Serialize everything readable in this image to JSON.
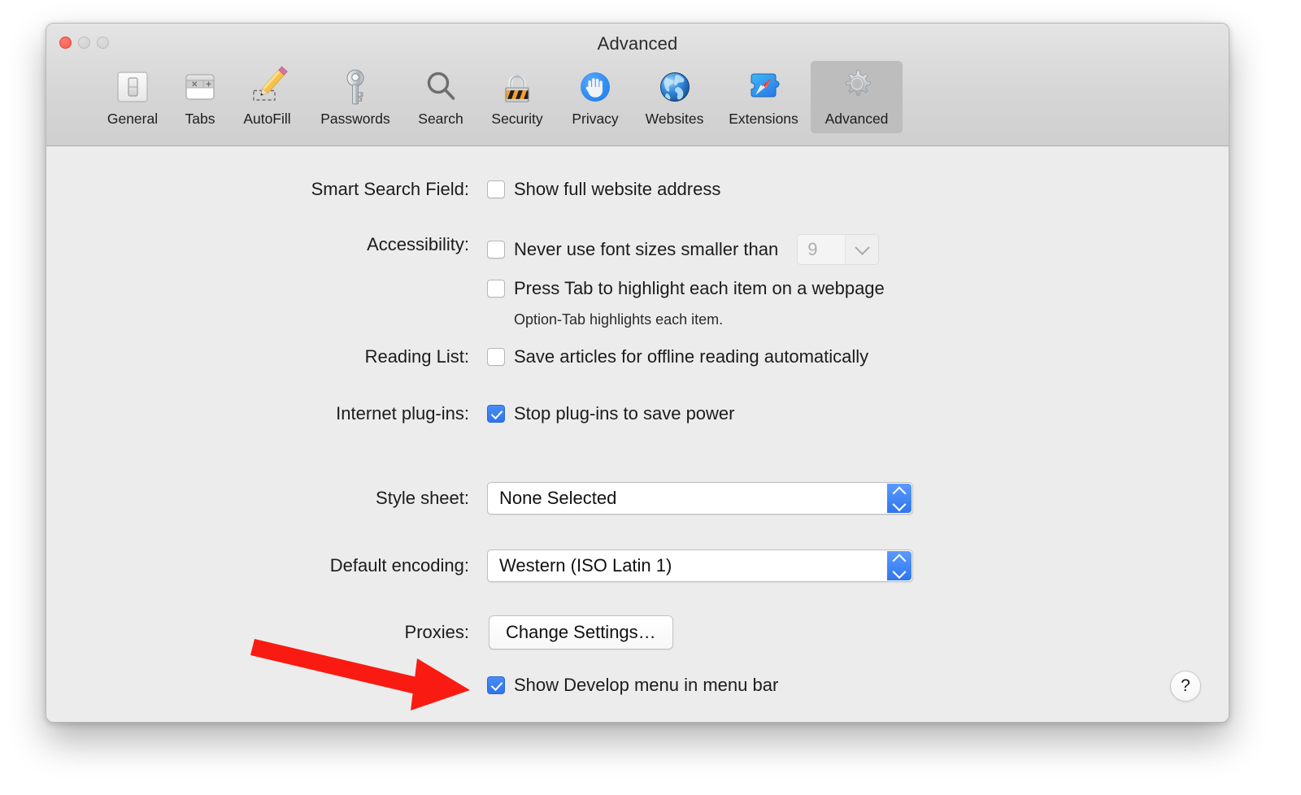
{
  "window": {
    "title": "Advanced",
    "traffic_lights": [
      {
        "name": "close",
        "color": "#fb5a4c"
      },
      {
        "name": "minimize",
        "color": "#cfcfcf"
      },
      {
        "name": "zoom",
        "color": "#cfcfcf"
      }
    ]
  },
  "toolbar": {
    "tabs": [
      {
        "label": "General",
        "icon": "general-switch-icon",
        "selected": false
      },
      {
        "label": "Tabs",
        "icon": "tabs-icon",
        "selected": false
      },
      {
        "label": "AutoFill",
        "icon": "pencil-icon",
        "selected": false
      },
      {
        "label": "Passwords",
        "icon": "key-icon",
        "selected": false
      },
      {
        "label": "Search",
        "icon": "magnifier-icon",
        "selected": false
      },
      {
        "label": "Security",
        "icon": "padlock-icon",
        "selected": false
      },
      {
        "label": "Privacy",
        "icon": "hand-icon",
        "selected": false
      },
      {
        "label": "Websites",
        "icon": "globe-icon",
        "selected": false
      },
      {
        "label": "Extensions",
        "icon": "puzzle-compass-icon",
        "selected": false
      },
      {
        "label": "Advanced",
        "icon": "gear-icon",
        "selected": true
      }
    ]
  },
  "settings": {
    "smart_search_field": {
      "label": "Smart Search Field:",
      "checkbox_label": "Show full website address",
      "checked": false
    },
    "accessibility": {
      "label": "Accessibility:",
      "min_font": {
        "checkbox_label": "Never use font sizes smaller than",
        "checked": false,
        "value": "9",
        "disabled": true
      },
      "press_tab": {
        "checkbox_label": "Press Tab to highlight each item on a webpage",
        "checked": false
      },
      "hint": "Option-Tab highlights each item."
    },
    "reading_list": {
      "label": "Reading List:",
      "checkbox_label": "Save articles for offline reading automatically",
      "checked": false
    },
    "internet_plugins": {
      "label": "Internet plug-ins:",
      "checkbox_label": "Stop plug-ins to save power",
      "checked": true
    },
    "style_sheet": {
      "label": "Style sheet:",
      "value": "None Selected"
    },
    "default_encoding": {
      "label": "Default encoding:",
      "value": "Western (ISO Latin 1)"
    },
    "proxies": {
      "label": "Proxies:",
      "button_label": "Change Settings…"
    },
    "develop_menu": {
      "checkbox_label": "Show Develop menu in menu bar",
      "checked": true
    }
  },
  "help_button": {
    "glyph": "?"
  },
  "annotation": {
    "arrow_color": "#f91b11",
    "points_to": "develop-menu-checkbox"
  },
  "colors": {
    "accent_blue": "#2f74ec",
    "window_bg": "#ececec",
    "toolbar_bg": "#d6d6d6",
    "selected_tab_bg": "#bdbdbd",
    "annotation_red": "#f91b11"
  }
}
